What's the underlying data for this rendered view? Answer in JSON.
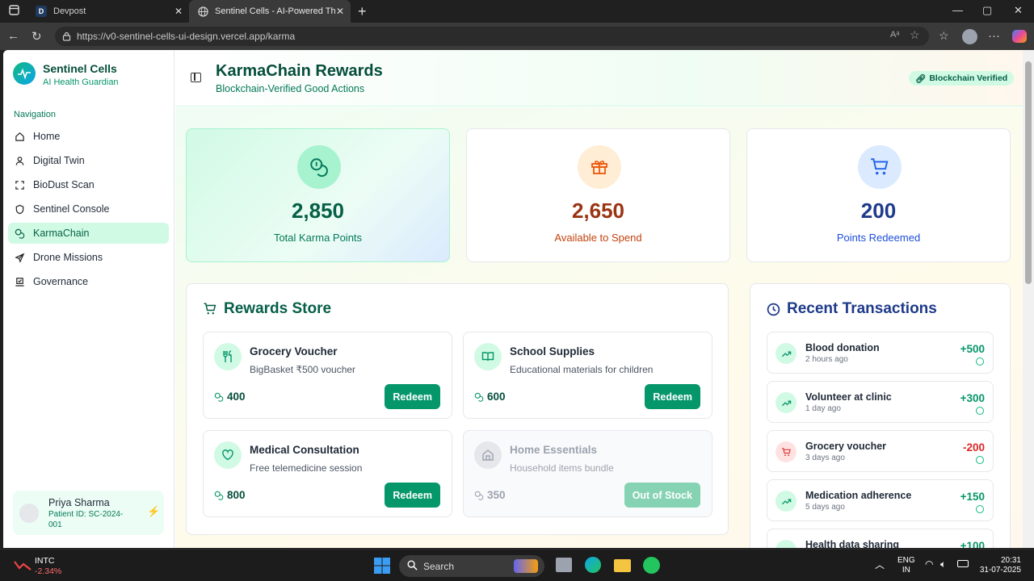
{
  "browser": {
    "tabs": [
      {
        "label": "Devpost",
        "icon": "D"
      },
      {
        "label": "Sentinel Cells - AI-Powered Thalas"
      }
    ],
    "url": "https://v0-sentinel-cells-ui-design.vercel.app/karma"
  },
  "sidebar": {
    "brand": "Sentinel Cells",
    "brand_sub": "AI Health Guardian",
    "nav_label": "Navigation",
    "items": [
      {
        "label": "Home",
        "icon": "home-icon"
      },
      {
        "label": "Digital Twin",
        "icon": "user-icon"
      },
      {
        "label": "BioDust Scan",
        "icon": "scan-icon"
      },
      {
        "label": "Sentinel Console",
        "icon": "shield-icon"
      },
      {
        "label": "KarmaChain",
        "icon": "coins-icon",
        "active": true
      },
      {
        "label": "Drone Missions",
        "icon": "plane-icon"
      },
      {
        "label": "Governance",
        "icon": "vote-icon"
      }
    ],
    "user": {
      "name": "Priya Sharma",
      "id": "Patient ID: SC-2024-001"
    }
  },
  "header": {
    "title": "KarmaChain Rewards",
    "subtitle": "Blockchain-Verified Good Actions",
    "badge": "Blockchain Verified"
  },
  "stats": [
    {
      "value": "2,850",
      "label": "Total Karma Points",
      "color": "#065f46",
      "label_color": "#047857",
      "icon": "coins-icon"
    },
    {
      "value": "2,650",
      "label": "Available to Spend",
      "color": "#9a3412",
      "label_color": "#c2410c",
      "icon": "gift-icon"
    },
    {
      "value": "200",
      "label": "Points Redeemed",
      "color": "#1e3a8a",
      "label_color": "#1d4ed8",
      "icon": "cart-icon"
    }
  ],
  "store": {
    "title": "Rewards Store",
    "items": [
      {
        "name": "Grocery Voucher",
        "desc": "BigBasket ₹500 voucher",
        "points": "400",
        "button": "Redeem",
        "icon": "utensils-icon"
      },
      {
        "name": "School Supplies",
        "desc": "Educational materials for children",
        "points": "600",
        "button": "Redeem",
        "icon": "book-icon"
      },
      {
        "name": "Medical Consultation",
        "desc": "Free telemedicine session",
        "points": "800",
        "button": "Redeem",
        "icon": "heart-icon"
      },
      {
        "name": "Home Essentials",
        "desc": "Household items bundle",
        "points": "350",
        "button": "Out of Stock",
        "icon": "house-icon",
        "disabled": true
      }
    ]
  },
  "transactions": {
    "title": "Recent Transactions",
    "items": [
      {
        "name": "Blood donation",
        "time": "2 hours ago",
        "amount": "+500",
        "type": "earn"
      },
      {
        "name": "Volunteer at clinic",
        "time": "1 day ago",
        "amount": "+300",
        "type": "earn"
      },
      {
        "name": "Grocery voucher",
        "time": "3 days ago",
        "amount": "-200",
        "type": "spend"
      },
      {
        "name": "Medication adherence",
        "time": "5 days ago",
        "amount": "+150",
        "type": "earn"
      },
      {
        "name": "Health data sharing",
        "time": "",
        "amount": "+100",
        "type": "earn"
      }
    ]
  },
  "taskbar": {
    "ticker": "INTC",
    "ticker_change": "-2.34%",
    "search": "Search",
    "lang1": "ENG",
    "lang2": "IN",
    "time": "20:31",
    "date": "31-07-2025"
  }
}
